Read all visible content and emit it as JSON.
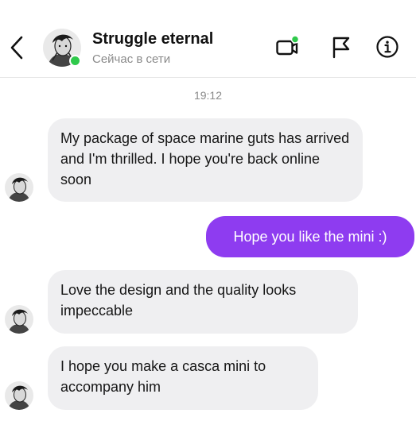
{
  "header": {
    "title": "Struggle eternal",
    "status": "Сейчас в сети",
    "icons": [
      "back-chevron-icon",
      "video-call-icon",
      "flag-icon",
      "info-icon"
    ],
    "online_color": "#2fc94b"
  },
  "conversation": {
    "timestamp": "19:12",
    "messages": [
      {
        "sender": "them",
        "text": "My package of space marine guts has arrived and I'm thrilled. I hope you're back online soon"
      },
      {
        "sender": "me",
        "text": "Hope you like the mini :)"
      },
      {
        "sender": "them",
        "text": "Love the design and the quality looks impeccable"
      },
      {
        "sender": "them",
        "text": "I hope you make a casca mini to accompany him"
      }
    ]
  },
  "colors": {
    "outgoing_bubble": "#8e3cf0",
    "incoming_bubble": "#efeff1",
    "muted_text": "#8a8a8a"
  }
}
